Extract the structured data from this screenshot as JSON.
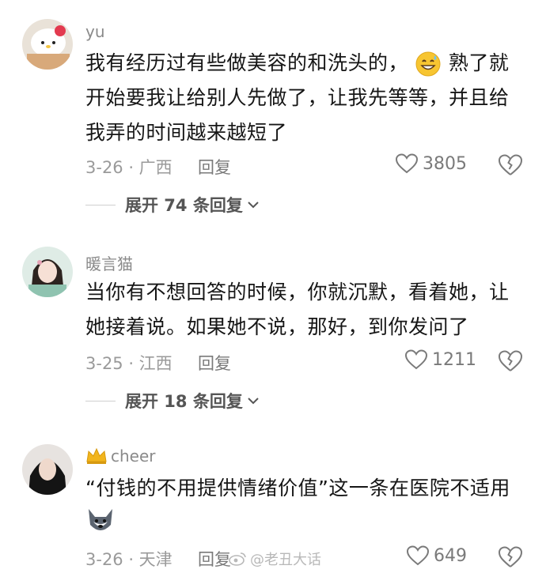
{
  "comments": [
    {
      "username": "yu",
      "text_lines": [
        "我有经历过有些做美容的和洗头的，",
        "开始要我让给别人先做了，让我先等等，并且给",
        "我弄的时间越来越短了"
      ],
      "text_tail_after_emoji": "熟了就",
      "date_location": "3-26 · 广西",
      "reply_label": "回复",
      "likes": "3805",
      "expand_label": "展开 74 条回复"
    },
    {
      "username": "暖言猫",
      "text_lines": [
        "当你有不想回答的时候，你就沉默，看着她，让",
        "她接着说。如果她不说，那好，到你发问了"
      ],
      "date_location": "3-25 · 江西",
      "reply_label": "回复",
      "likes": "1211",
      "expand_label": "展开 18 条回复"
    },
    {
      "username": "cheer",
      "text_lines": [
        "“付钱的不用提供情绪价值”这一条在医院不适用"
      ],
      "date_location": "3-26 · 天津",
      "reply_label": "回复",
      "likes": "649"
    }
  ],
  "watermark": "@老丑大话",
  "colors": {
    "text": "#161616",
    "muted": "#9a9a9a",
    "username": "#8a8a8a",
    "crown": "#f2b51d"
  }
}
